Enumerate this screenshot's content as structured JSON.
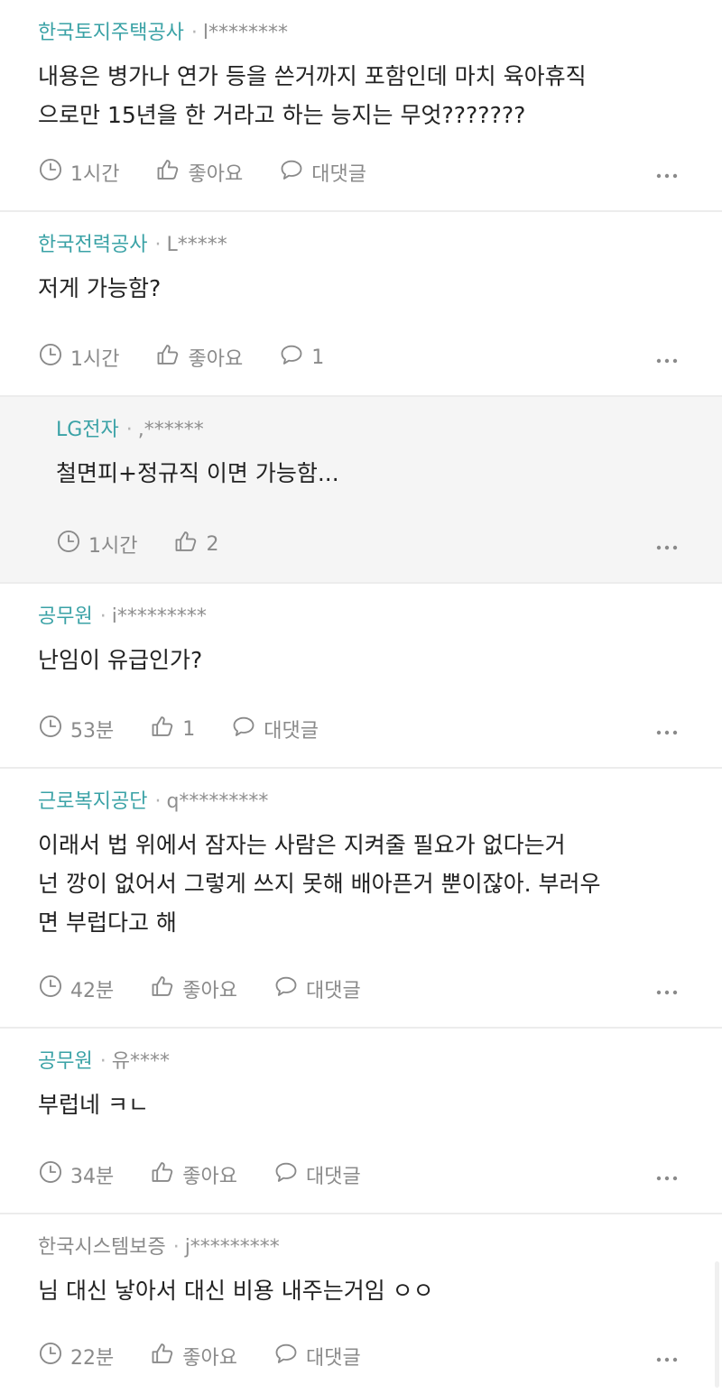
{
  "comments": [
    {
      "company": "한국토지주택공사",
      "user": "l********",
      "lines": [
        "내용은 병가나 연가 등을 쓴거까지 포함인데 마치 육아휴직",
        "으로만 15년을 한 거라고 하는 능지는 무엇???????"
      ],
      "time": "1시간",
      "like": "좋아요",
      "reply": "대댓글"
    },
    {
      "company": "한국전력공사",
      "user": "L*****",
      "lines": [
        "저게 가능함?"
      ],
      "time": "1시간",
      "like": "좋아요",
      "reply": "1"
    },
    {
      "company": "LG전자",
      "user": ",******",
      "lines": [
        "철면피+정규직 이면 가능함..."
      ],
      "time": "1시간",
      "like": "2",
      "reply": ""
    },
    {
      "company": "공무원",
      "user": "i*********",
      "lines": [
        "난임이 유급인가?"
      ],
      "time": "53분",
      "like": "1",
      "reply": "대댓글"
    },
    {
      "company": "근로복지공단",
      "user": "q*********",
      "lines": [
        "이래서 법 위에서 잠자는 사람은 지켜줄 필요가 없다는거",
        "넌 깡이 없어서 그렇게 쓰지 못해 배아픈거 뿐이잖아. 부러우",
        "면 부럽다고 해"
      ],
      "time": "42분",
      "like": "좋아요",
      "reply": "대댓글"
    },
    {
      "company": "공무원",
      "user": "유****",
      "lines": [
        "부럽네 ㅋㄴ"
      ],
      "time": "34분",
      "like": "좋아요",
      "reply": "대댓글"
    },
    {
      "company": "한국시스템보증",
      "user": "j*********",
      "lines": [
        "님 대신 낳아서 대신 비용 내주는거임 ㅇㅇ"
      ],
      "time": "22분",
      "like": "좋아요",
      "reply": "대댓글"
    }
  ],
  "separator": "·",
  "colors": {
    "company_accent": "#3aa2a6",
    "meta_gray": "#8a8a8a",
    "reply_background": "#f5f5f5",
    "divider": "#ececec"
  },
  "icons": {
    "time": "clock-icon",
    "like": "thumbs-up-icon",
    "reply": "speech-bubble-icon",
    "more": "more-dots-icon"
  }
}
